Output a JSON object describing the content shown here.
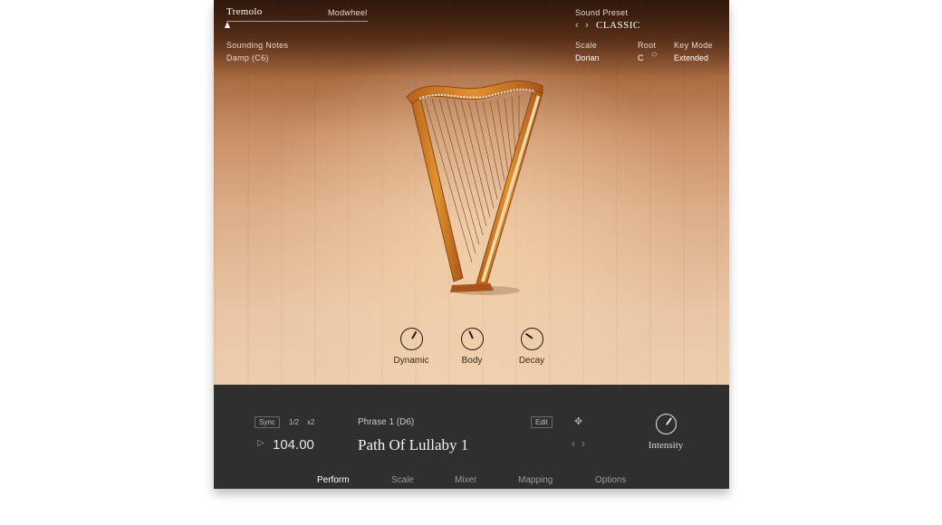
{
  "top_left": {
    "tremolo_label": "Tremolo",
    "modwheel_label": "Modwheel",
    "sounding_notes_label": "Sounding Notes",
    "sounding_notes_value": "Damp (C6)",
    "tremolo_amount": 0.0
  },
  "top_right": {
    "sound_preset_label": "Sound Preset",
    "sound_preset_value": "CLASSIC",
    "scale_label": "Scale",
    "scale_value": "Dorian",
    "root_label": "Root",
    "root_value": "C",
    "key_mode_label": "Key Mode",
    "key_mode_value": "Extended"
  },
  "knobs": [
    {
      "label": "Dynamic"
    },
    {
      "label": "Body"
    },
    {
      "label": "Decay"
    }
  ],
  "transport": {
    "sync_label": "Sync",
    "half_label": "1/2",
    "double_label": "x2",
    "tempo": "104.00"
  },
  "phrase": {
    "header": "Phrase 1 (D6)",
    "name": "Path Of Lullaby 1",
    "edit_label": "Edit"
  },
  "intensity_label": "Intensity",
  "tabs": [
    {
      "label": "Perform",
      "active": true
    },
    {
      "label": "Scale",
      "active": false
    },
    {
      "label": "Mixer",
      "active": false
    },
    {
      "label": "Mapping",
      "active": false
    },
    {
      "label": "Options",
      "active": false
    }
  ],
  "colors": {
    "panel": "#2f2f2f",
    "accent_text": "#ffffff",
    "wood": "#dcae89"
  }
}
